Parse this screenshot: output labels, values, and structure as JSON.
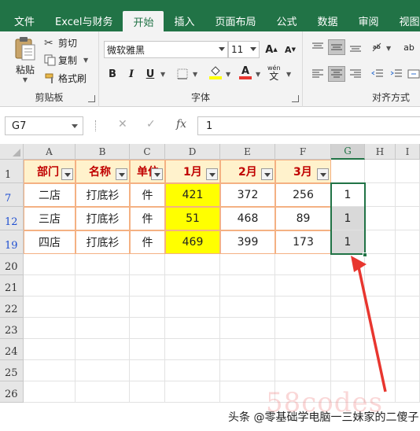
{
  "tabs": [
    "文件",
    "Excel与财务",
    "开始",
    "插入",
    "页面布局",
    "公式",
    "数据",
    "审阅",
    "视图"
  ],
  "active_tab": "开始",
  "ribbon": {
    "clipboard": {
      "paste": "粘贴",
      "cut": "剪切",
      "copy": "复制",
      "format_painter": "格式刷",
      "label": "剪贴板"
    },
    "font": {
      "name": "微软雅黑",
      "size": "11",
      "grow": "A",
      "shrink": "A",
      "bold": "B",
      "italic": "I",
      "underline": "U",
      "font_color_letter": "A",
      "wen": "wén",
      "wen_char": "文",
      "label": "字体"
    },
    "alignment": {
      "label": "对齐方式",
      "partial_char": "ab"
    }
  },
  "formula_bar": {
    "name_box": "G7",
    "fx": "fx",
    "value": "1"
  },
  "columns": [
    "A",
    "B",
    "C",
    "D",
    "E",
    "F",
    "G",
    "H",
    "I"
  ],
  "selected_column": "G",
  "header_row": {
    "row": "1",
    "cells": [
      "部门",
      "名称",
      "单位",
      "1月",
      "2月",
      "3月"
    ]
  },
  "data_rows": [
    {
      "row": "7",
      "cells": [
        "二店",
        "打底衫",
        "件",
        "421",
        "372",
        "256",
        "1"
      ]
    },
    {
      "row": "12",
      "cells": [
        "三店",
        "打底衫",
        "件",
        "51",
        "468",
        "89",
        "1"
      ]
    },
    {
      "row": "19",
      "cells": [
        "四店",
        "打底衫",
        "件",
        "469",
        "399",
        "173",
        "1"
      ]
    }
  ],
  "empty_rows": [
    "20",
    "21",
    "22",
    "23",
    "24",
    "25",
    "26"
  ],
  "watermark": "头条 @零基础学电脑一三妹家的二傻子",
  "logo": "58codes",
  "colors": {
    "excel_green": "#217346",
    "header_red": "#c00000",
    "highlight_yellow": "#ffff00",
    "arrow_red": "#e8362f"
  }
}
